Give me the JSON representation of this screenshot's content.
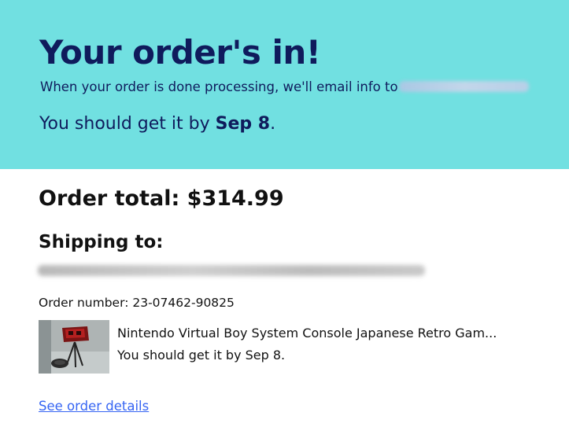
{
  "banner": {
    "headline": "Your order's in!",
    "email_note": "When your order is done processing, we'll email info to",
    "eta_prefix": "You should get it by ",
    "eta_date": "Sep 8",
    "eta_suffix": "."
  },
  "order": {
    "total_label": "Order total: $314.99",
    "shipping_heading": "Shipping to:",
    "order_number_label": "Order number: ",
    "order_number": "23-07462-90825"
  },
  "item": {
    "title": "Nintendo Virtual Boy System Console Japanese Retro Gam...",
    "eta": "You should get it by Sep 8."
  },
  "links": {
    "see_order_details": "See order details"
  },
  "colors": {
    "banner_bg": "#71e0e1",
    "banner_text": "#0f1b5c",
    "link": "#3665f3"
  }
}
